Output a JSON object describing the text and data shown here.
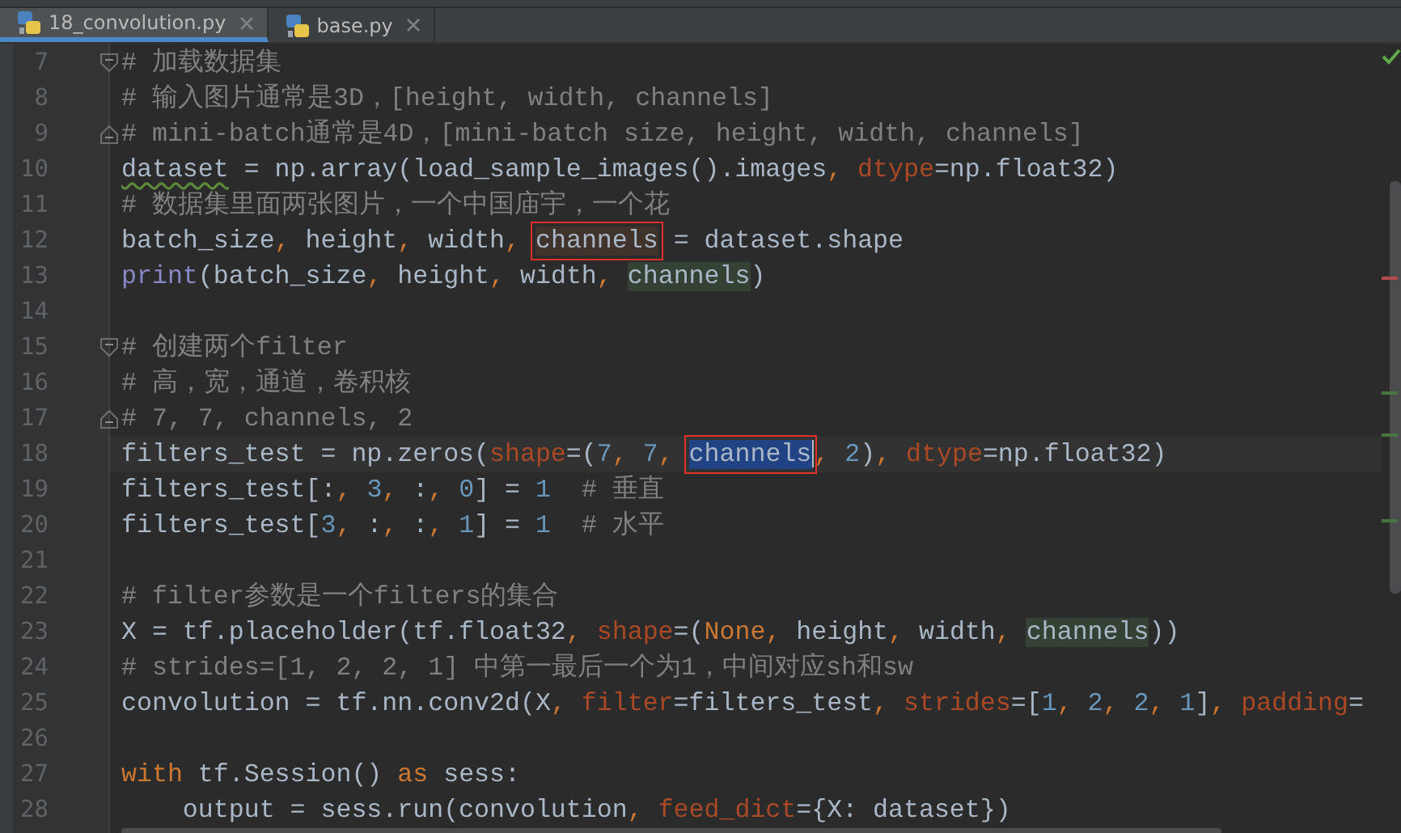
{
  "tabs": [
    {
      "label": "18_convolution.py",
      "selected": true
    },
    {
      "label": "base.py",
      "selected": false
    }
  ],
  "lines": [
    {
      "number": "7",
      "fold_start": true,
      "tokens": [
        {
          "text": "# 加载数据集",
          "kind": "comment"
        }
      ]
    },
    {
      "number": "8",
      "tokens": [
        {
          "text": "# 输入图片通常是3D，[height, width, channels]",
          "kind": "comment"
        }
      ]
    },
    {
      "number": "9",
      "fold_end": true,
      "tokens": [
        {
          "text": "# mini-batch通常是4D，[mini-batch size, height, width, channels]",
          "kind": "comment"
        }
      ]
    },
    {
      "number": "10",
      "tokens": [
        {
          "text": "dataset",
          "kind": "text",
          "warning": true
        },
        {
          "text": " = np.array(load_sample_images().images",
          "kind": "text"
        },
        {
          "text": ", ",
          "kind": "comma"
        },
        {
          "text": "dtype",
          "kind": "param"
        },
        {
          "text": "=np.float32)",
          "kind": "text"
        }
      ]
    },
    {
      "number": "11",
      "tokens": [
        {
          "text": "# 数据集里面两张图片，一个中国庙宇，一个花",
          "kind": "comment"
        }
      ]
    },
    {
      "number": "12",
      "tokens": [
        {
          "text": "batch_size",
          "kind": "text"
        },
        {
          "text": ", ",
          "kind": "comma"
        },
        {
          "text": "height",
          "kind": "text"
        },
        {
          "text": ", ",
          "kind": "comma"
        },
        {
          "text": "width",
          "kind": "text"
        },
        {
          "text": ", ",
          "kind": "comma"
        },
        {
          "text": "channels",
          "kind": "text",
          "write_usage": true,
          "boxed": true
        },
        {
          "text": " = dataset.shape",
          "kind": "text"
        }
      ]
    },
    {
      "number": "13",
      "tokens": [
        {
          "text": "print",
          "kind": "builtin"
        },
        {
          "text": "(batch_size",
          "kind": "text"
        },
        {
          "text": ", ",
          "kind": "comma"
        },
        {
          "text": "height",
          "kind": "text"
        },
        {
          "text": ", ",
          "kind": "comma"
        },
        {
          "text": "width",
          "kind": "text"
        },
        {
          "text": ", ",
          "kind": "comma"
        },
        {
          "text": "channels",
          "kind": "text",
          "usage": true
        },
        {
          "text": ")",
          "kind": "text"
        }
      ]
    },
    {
      "number": "14"
    },
    {
      "number": "15",
      "fold_start": true,
      "tokens": [
        {
          "text": "# 创建两个filter",
          "kind": "comment"
        }
      ]
    },
    {
      "number": "16",
      "tokens": [
        {
          "text": "# 高，宽，通道，卷积核",
          "kind": "comment"
        }
      ]
    },
    {
      "number": "17",
      "fold_end": true,
      "tokens": [
        {
          "text": "# 7, 7, channels, 2",
          "kind": "comment"
        }
      ]
    },
    {
      "number": "18",
      "current": true,
      "tokens": [
        {
          "text": "filters_test = np.zeros(",
          "kind": "text"
        },
        {
          "text": "shape",
          "kind": "param"
        },
        {
          "text": "=(",
          "kind": "text"
        },
        {
          "text": "7",
          "kind": "number"
        },
        {
          "text": ", ",
          "kind": "comma"
        },
        {
          "text": "7",
          "kind": "number"
        },
        {
          "text": ", ",
          "kind": "comma"
        },
        {
          "text": "channels",
          "kind": "text",
          "selected": true,
          "boxed": true
        },
        {
          "text": ", ",
          "kind": "comma"
        },
        {
          "text": "2",
          "kind": "number"
        },
        {
          "text": ")",
          "kind": "text"
        },
        {
          "text": ", ",
          "kind": "comma"
        },
        {
          "text": "dtype",
          "kind": "param"
        },
        {
          "text": "=np.float32)",
          "kind": "text"
        }
      ]
    },
    {
      "number": "19",
      "tokens": [
        {
          "text": "filters_test[:",
          "kind": "text"
        },
        {
          "text": ", ",
          "kind": "comma"
        },
        {
          "text": "3",
          "kind": "number"
        },
        {
          "text": ", ",
          "kind": "comma"
        },
        {
          "text": ":",
          "kind": "text"
        },
        {
          "text": ", ",
          "kind": "comma"
        },
        {
          "text": "0",
          "kind": "number"
        },
        {
          "text": "] = ",
          "kind": "text"
        },
        {
          "text": "1",
          "kind": "number"
        },
        {
          "text": "  # 垂直",
          "kind": "comment"
        }
      ]
    },
    {
      "number": "20",
      "tokens": [
        {
          "text": "filters_test[",
          "kind": "text"
        },
        {
          "text": "3",
          "kind": "number"
        },
        {
          "text": ", ",
          "kind": "comma"
        },
        {
          "text": ":",
          "kind": "text"
        },
        {
          "text": ", ",
          "kind": "comma"
        },
        {
          "text": ":",
          "kind": "text"
        },
        {
          "text": ", ",
          "kind": "comma"
        },
        {
          "text": "1",
          "kind": "number"
        },
        {
          "text": "] = ",
          "kind": "text"
        },
        {
          "text": "1",
          "kind": "number"
        },
        {
          "text": "  # 水平",
          "kind": "comment"
        }
      ]
    },
    {
      "number": "21"
    },
    {
      "number": "22",
      "tokens": [
        {
          "text": "# filter参数是一个filters的集合",
          "kind": "comment"
        }
      ]
    },
    {
      "number": "23",
      "tokens": [
        {
          "text": "X = tf.placeholder(tf.float32",
          "kind": "text"
        },
        {
          "text": ", ",
          "kind": "comma"
        },
        {
          "text": "shape",
          "kind": "param"
        },
        {
          "text": "=(",
          "kind": "text"
        },
        {
          "text": "None",
          "kind": "keyword"
        },
        {
          "text": ", ",
          "kind": "comma"
        },
        {
          "text": "height",
          "kind": "text"
        },
        {
          "text": ", ",
          "kind": "comma"
        },
        {
          "text": "width",
          "kind": "text"
        },
        {
          "text": ", ",
          "kind": "comma"
        },
        {
          "text": "channels",
          "kind": "text",
          "usage": true
        },
        {
          "text": "))",
          "kind": "text"
        }
      ]
    },
    {
      "number": "24",
      "tokens": [
        {
          "text": "# strides=[1, 2, 2, 1] 中第一最后一个为1，中间对应sh和sw",
          "kind": "comment"
        }
      ]
    },
    {
      "number": "25",
      "tokens": [
        {
          "text": "convolution = tf.nn.conv2d(X",
          "kind": "text"
        },
        {
          "text": ", ",
          "kind": "comma"
        },
        {
          "text": "filter",
          "kind": "param"
        },
        {
          "text": "=filters_test",
          "kind": "text"
        },
        {
          "text": ", ",
          "kind": "comma"
        },
        {
          "text": "strides",
          "kind": "param"
        },
        {
          "text": "=[",
          "kind": "text"
        },
        {
          "text": "1",
          "kind": "number"
        },
        {
          "text": ", ",
          "kind": "comma"
        },
        {
          "text": "2",
          "kind": "number"
        },
        {
          "text": ", ",
          "kind": "comma"
        },
        {
          "text": "2",
          "kind": "number"
        },
        {
          "text": ", ",
          "kind": "comma"
        },
        {
          "text": "1",
          "kind": "number"
        },
        {
          "text": "]",
          "kind": "text"
        },
        {
          "text": ", ",
          "kind": "comma"
        },
        {
          "text": "padding",
          "kind": "param"
        },
        {
          "text": "=",
          "kind": "text"
        }
      ]
    },
    {
      "number": "26"
    },
    {
      "number": "27",
      "tokens": [
        {
          "text": "with",
          "kind": "keyword"
        },
        {
          "text": " tf.Session() ",
          "kind": "text"
        },
        {
          "text": "as",
          "kind": "keyword"
        },
        {
          "text": " sess:",
          "kind": "text"
        }
      ]
    },
    {
      "number": "28",
      "tokens": [
        {
          "text": "    output = sess.run(convolution",
          "kind": "text"
        },
        {
          "text": ", ",
          "kind": "comma"
        },
        {
          "text": "feed_dict",
          "kind": "param"
        },
        {
          "text": "={X: dataset})",
          "kind": "text"
        }
      ]
    }
  ]
}
